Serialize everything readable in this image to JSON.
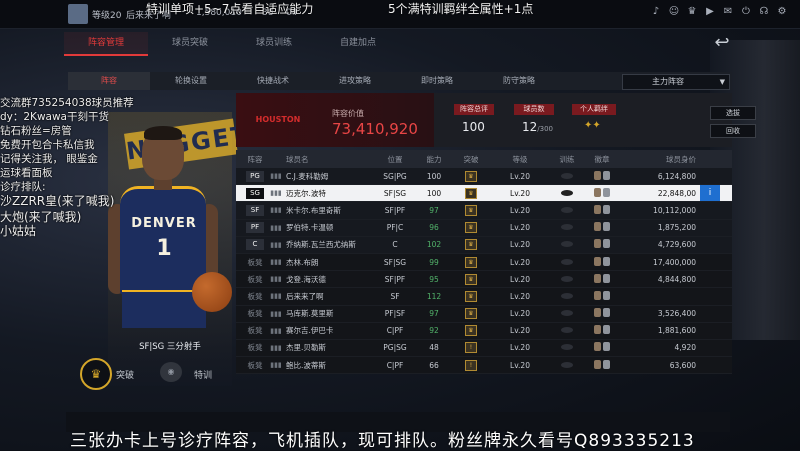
{
  "topbar": {
    "level": "等级20",
    "stats": [
      "后来来了啊",
      "1,580,010",
      "38",
      "04"
    ],
    "icons": [
      "bell-icon",
      "user-icon",
      "trophy-icon",
      "play-icon",
      "mail-icon",
      "power-icon",
      "headset-icon",
      "gear-icon"
    ]
  },
  "overlay": {
    "top_left": "特训单项+5~7点看自适应能力",
    "top_right": "5个满特训羁绊全属性+1点",
    "left_lines": [
      "交流群735254038球员推荐",
      "dy：2Kwawa干刻干货",
      "钻石粉丝=房管",
      "免费开包合卡私信我",
      "记得关注我，  眼鉴金",
      "运球看面板",
      "诊疗排队:",
      "沙ZZRR皇(来了喊我)",
      "大炮(来了喊我)",
      "小姑姑"
    ],
    "bottom": "三张办卡上号诊疗阵容，飞机插队，现可排队。粉丝牌永久看号Q893335213"
  },
  "nav": {
    "tabs": [
      "阵容管理",
      "球员突破",
      "球员训练",
      "自建加点"
    ]
  },
  "subtabs": [
    "阵容",
    "轮换设置",
    "快捷战术",
    "进攻策略",
    "即时策略",
    "防守策略"
  ],
  "formation": "主力阵容",
  "card": {
    "jersey_text": "DENVER",
    "jersey_number": "1",
    "banner": "NUGGETS",
    "position_label": "SF|SG 三分射手",
    "breakthrough": "突破",
    "train": "特训"
  },
  "team": {
    "logo_text": "HOUSTON ROCKETS",
    "value_label": "阵容价值",
    "value": "73,410,920",
    "total_rating_label": "阵容总评",
    "total_rating": "100",
    "player_count_label": "球员数",
    "player_count": "12",
    "player_count_max": "/300",
    "bond_label": "个人羁绊",
    "btn_select": "选拔",
    "btn_recycle": "回收"
  },
  "table": {
    "headers": [
      "阵容",
      "球员名",
      "位置",
      "能力",
      "突破",
      "等级",
      "训练",
      "徽章",
      "球员身价"
    ],
    "rows": [
      {
        "slot": "PG",
        "name": "C.J.麦科勒姆",
        "pos": "SG|PG",
        "rating": "100",
        "level": "Lv.20",
        "salary": "6,124,800",
        "type": "starter"
      },
      {
        "slot": "SG",
        "name": "迈克尔.波特",
        "pos": "SF|SG",
        "rating": "100",
        "level": "Lv.20",
        "salary": "22,848,00",
        "type": "selected"
      },
      {
        "slot": "SF",
        "name": "米卡尔.布里奇斯",
        "pos": "SF|PF",
        "rating": "97",
        "level": "Lv.20",
        "salary": "10,112,000",
        "type": "starter"
      },
      {
        "slot": "PF",
        "name": "罗伯特.卡温顿",
        "pos": "PF|C",
        "rating": "96",
        "level": "Lv.20",
        "salary": "1,875,200",
        "type": "starter"
      },
      {
        "slot": "C",
        "name": "乔纳斯.瓦兰西尤纳斯",
        "pos": "C",
        "rating": "102",
        "level": "Lv.20",
        "salary": "4,729,600",
        "type": "starter"
      },
      {
        "slot": "板凳",
        "name": "杰林.布朗",
        "pos": "SF|SG",
        "rating": "99",
        "level": "Lv.20",
        "salary": "17,400,000",
        "type": "bench"
      },
      {
        "slot": "板凳",
        "name": "戈登.海沃德",
        "pos": "SF|PF",
        "rating": "95",
        "level": "Lv.20",
        "salary": "4,844,800",
        "type": "bench"
      },
      {
        "slot": "板凳",
        "name": "后来来了啊",
        "pos": "SF",
        "rating": "112",
        "level": "Lv.20",
        "salary": "",
        "type": "bench"
      },
      {
        "slot": "板凳",
        "name": "马库斯.莫里斯",
        "pos": "PF|SF",
        "rating": "97",
        "level": "Lv.20",
        "salary": "3,526,400",
        "type": "bench"
      },
      {
        "slot": "板凳",
        "name": "赛尔吉.伊巴卡",
        "pos": "C|PF",
        "rating": "92",
        "level": "Lv.20",
        "salary": "1,881,600",
        "type": "bench"
      },
      {
        "slot": "板凳",
        "name": "杰里.贝勒斯",
        "pos": "PG|SG",
        "rating": "48",
        "level": "Lv.20",
        "salary": "4,920",
        "type": "bench"
      },
      {
        "slot": "板凳",
        "name": "鲍比.波蒂斯",
        "pos": "C|PF",
        "rating": "66",
        "level": "Lv.20",
        "salary": "63,600",
        "type": "bench"
      }
    ]
  },
  "colors": {
    "accent_red": "#e23a3a",
    "gold": "#d4a62a",
    "info_blue": "#1f6fd0",
    "green_rating": "#52b36a"
  }
}
